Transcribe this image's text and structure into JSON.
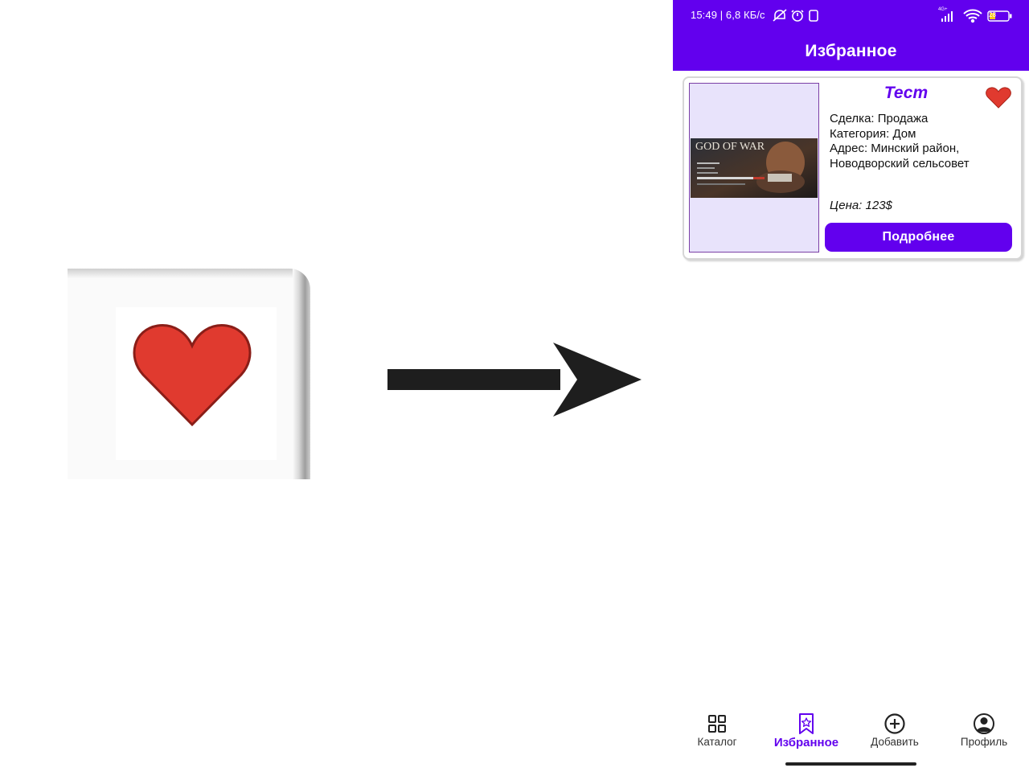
{
  "zoom": {
    "icon": "heart-icon",
    "heart_color": "#e03a2f"
  },
  "arrow": {
    "icon": "arrow-right-icon",
    "color": "#1e1e1e"
  },
  "phone": {
    "status_bar": {
      "text": "15:49 | 6,8 КБ/с",
      "icons": [
        "mute-notifications-icon",
        "alarm-icon",
        "screen-icon",
        "signal-icon",
        "wifi-icon",
        "battery-icon"
      ],
      "signal_label": "4G+",
      "battery_level": "28"
    },
    "app_bar": {
      "title": "Избранное"
    },
    "card": {
      "title": "Тест",
      "favorite_icon": "heart-icon",
      "deal": "Сделка: Продажа",
      "category": "Категория: Дом",
      "address_line1": "Адрес: Минский район,",
      "address_line2": "Новодворский сельсовет",
      "price": "Цена: 123$",
      "details_button": "Подробнее",
      "thumb": {
        "caption": "GOD OF WAR"
      }
    },
    "bottom_nav": [
      {
        "label": "Каталог",
        "icon": "grid-icon",
        "active": false
      },
      {
        "label": "Избранное",
        "icon": "bookmark-star-icon",
        "active": true
      },
      {
        "label": "Добавить",
        "icon": "add-circle-icon",
        "active": false
      },
      {
        "label": "Профиль",
        "icon": "account-circle-icon",
        "active": false
      }
    ],
    "colors": {
      "primary": "#6200ee",
      "card_image_bg": "#e8e3fb",
      "heart": "#e03a2f"
    }
  }
}
